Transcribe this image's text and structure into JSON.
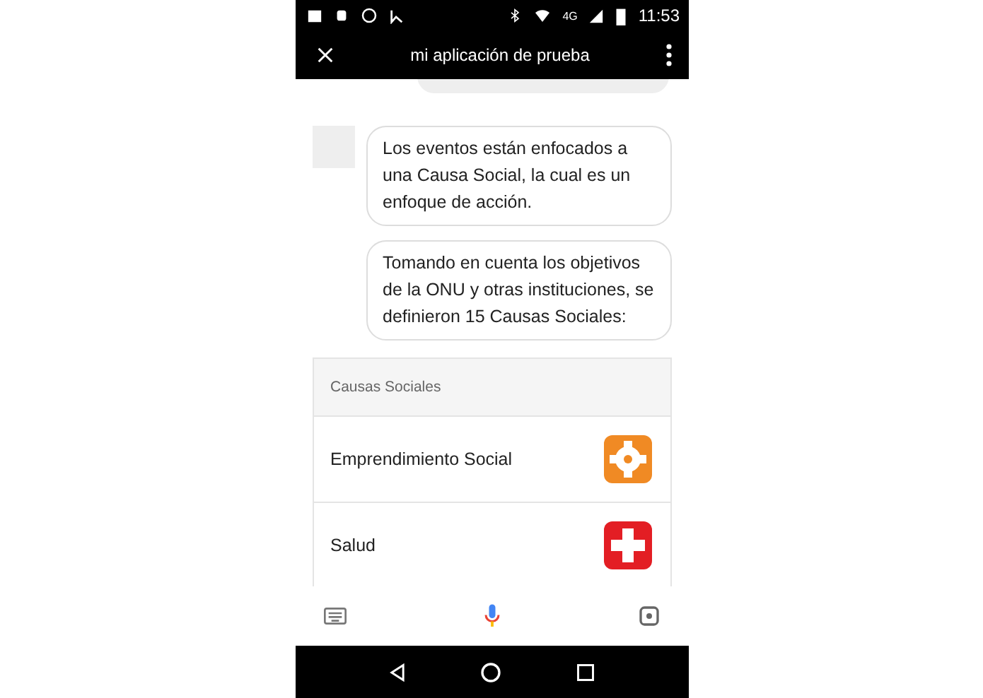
{
  "status_bar": {
    "time": "11:53",
    "network": "4G"
  },
  "app_bar": {
    "title": "mi aplicación de prueba"
  },
  "messages": [
    {
      "kind": "bot",
      "text": "Los eventos están enfocados a una Causa Social, la cual es un enfoque de acción.",
      "avatar": true
    },
    {
      "kind": "bot",
      "text": "Tomando en cuenta los objetivos de la ONU y otras instituciones, se definieron 15 Causas Sociales:",
      "avatar": false
    }
  ],
  "list_card": {
    "header": "Causas Sociales",
    "items": [
      {
        "label": "Emprendimiento Social",
        "kind": "gear",
        "color": "#f08a24"
      },
      {
        "label": "Salud",
        "kind": "cross",
        "color": "#e31e24"
      }
    ]
  }
}
